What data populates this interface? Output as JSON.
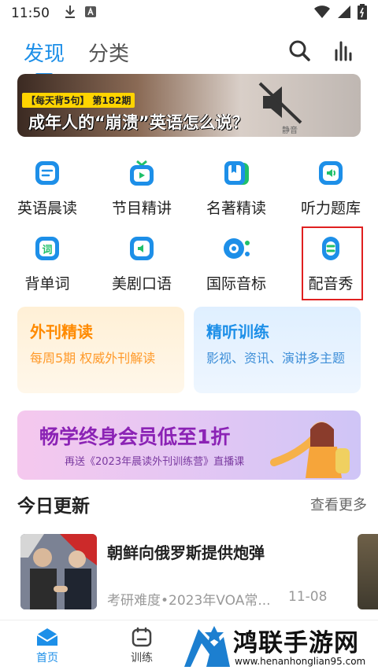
{
  "status_bar": {
    "time": "11:50"
  },
  "top_tabs": [
    {
      "label": "发现"
    },
    {
      "label": "分类"
    }
  ],
  "banner": {
    "badge_series": "【每天背5句】",
    "badge_issue": "第182期",
    "headline": "成年人的“崩溃”英语怎么说？",
    "watermark": "静音"
  },
  "grid": [
    {
      "label": "英语晨读",
      "icon": "document-icon",
      "color": "#1d8fe8"
    },
    {
      "label": "节目精讲",
      "icon": "tv-icon",
      "color": "#1d8fe8"
    },
    {
      "label": "名著精读",
      "icon": "bookmark-book-icon",
      "color": "#1d8fe8"
    },
    {
      "label": "听力题库",
      "icon": "audio-icon",
      "color": "#1d8fe8"
    },
    {
      "label": "背单词",
      "icon": "word-icon",
      "color": "#1d8fe8"
    },
    {
      "label": "美剧口语",
      "icon": "speech-icon",
      "color": "#1d8fe8"
    },
    {
      "label": "国际音标",
      "icon": "phonetic-icon",
      "color": "#1d8fe8"
    },
    {
      "label": "配音秀",
      "icon": "dubbing-icon",
      "color": "#1d8fe8"
    }
  ],
  "promos": {
    "left": {
      "title": "外刊精读",
      "subtitle": "每周5期 权威外刊解读"
    },
    "right": {
      "title": "精听训练",
      "subtitle": "影视、资讯、演讲多主题"
    }
  },
  "vip_banner": {
    "title": "畅学终身会员低至1折",
    "subtitle": "再送《2023年晨读外刊训练营》直播课"
  },
  "section": {
    "title": "今日更新",
    "more": "查看更多"
  },
  "news": [
    {
      "title": "朝鲜向俄罗斯提供炮弹",
      "meta": "考研难度•2023年VOA常...",
      "date": "11-08"
    }
  ],
  "bottom_nav": [
    {
      "label": "首页"
    },
    {
      "label": "训练"
    }
  ],
  "watermark": {
    "title": "鸿联手游网",
    "url": "www.henanhonglian95.com"
  },
  "colors": {
    "accent": "#1d8fe8",
    "orange": "#ff8a00",
    "purple": "#8b23b5",
    "highlight_box": "#e02020"
  }
}
